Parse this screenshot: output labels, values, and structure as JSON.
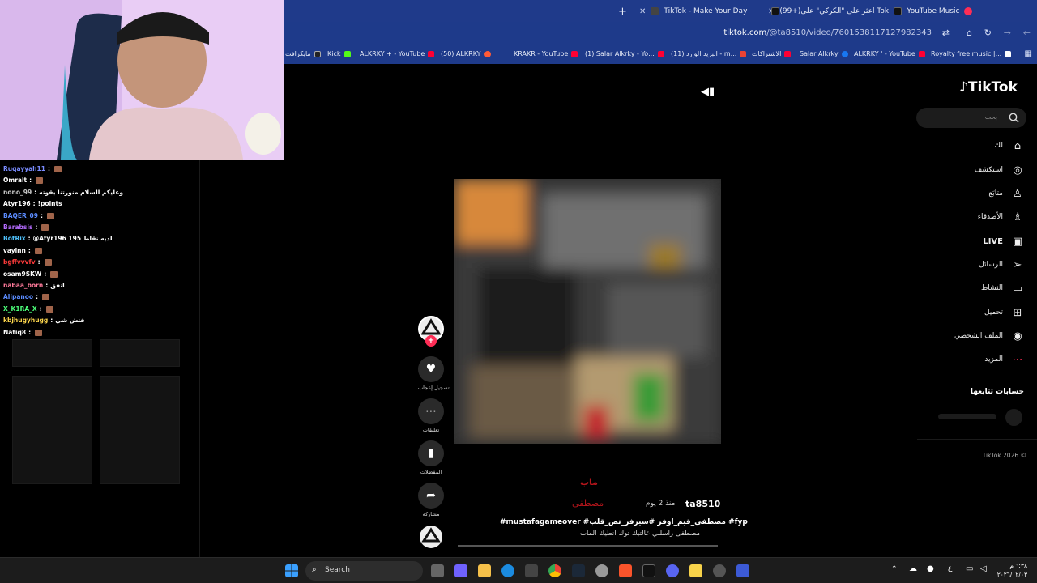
{
  "browser": {
    "tabs": [
      {
        "label": "YouTube Music"
      },
      {
        "label": "(99+)اعثر على \"الكركي\" على Tok"
      },
      {
        "label": "TikTok - Make Your Day"
      }
    ],
    "new_tab_symbol": "+",
    "url_domain": "tiktok.com",
    "url_path": "/@ta8510/video/7601538117127982343",
    "bookmarks": [
      "Royalty free music |...",
      "ALKRKY ' - YouTube",
      "Salar Alkrky",
      "الاشتراكات",
      "البريد الوارد (11) - m...",
      "(1) Salar Alkrky - Yo...",
      "KRAKR - YouTube",
      "(50) ALKRKY",
      "ALKRKY + - YouTube",
      "Kick",
      "مايكرافت"
    ]
  },
  "tiktok": {
    "logo": "TikTok",
    "search_placeholder": "بحث",
    "nav": [
      {
        "label": "لك",
        "icon": "home-icon"
      },
      {
        "label": "استكشف",
        "icon": "compass-icon"
      },
      {
        "label": "متابَع",
        "icon": "user-follow-icon"
      },
      {
        "label": "الأصدقاء",
        "icon": "friends-icon"
      },
      {
        "label": "LIVE",
        "icon": "live-icon"
      },
      {
        "label": "الرسائل",
        "icon": "send-icon"
      },
      {
        "label": "النشاط",
        "icon": "activity-icon"
      },
      {
        "label": "تحميل",
        "icon": "upload-icon"
      },
      {
        "label": "الملف الشخصي",
        "icon": "profile-avatar-icon"
      },
      {
        "label": "المزيد",
        "icon": "more-icon"
      }
    ],
    "following_heading": "حسابات تتابعها",
    "footer": "TikTok 2026 ©",
    "video": {
      "author": "ta8510",
      "time": "منذ 2 يوم",
      "overlay_line1": "ماب",
      "overlay_line2": "مصطفى",
      "hashtags": "#mustafagameover #مصطفى_قيم_اوفر #سيرفر_نص_قلب #fyp",
      "caption": "مصطفى راسلني عالتيك توك انطيك الماب"
    },
    "actions": [
      {
        "label": "تسجيل إعجاب",
        "icon": "heart-icon"
      },
      {
        "label": "تعليقات",
        "icon": "comment-icon"
      },
      {
        "label": "المفضلات",
        "icon": "bookmark-icon"
      },
      {
        "label": "مشاركة",
        "icon": "share-icon"
      }
    ],
    "follow_badge": "+"
  },
  "chat": {
    "messages": [
      {
        "user": "Ruqayyah11",
        "sep": ":",
        "text": "",
        "color": "#7a8cff"
      },
      {
        "user": "Omralt",
        "sep": ":",
        "text": "",
        "color": "#ffffff"
      },
      {
        "user": "nono_99",
        "sep": ":",
        "text": "وعليكم السلام منورتنا بقوته",
        "color": "#c5c5c5"
      },
      {
        "user": "Atyr196",
        "sep": ":",
        "text": "!points",
        "color": "#ffffff"
      },
      {
        "user": "BAQER_09",
        "sep": ":",
        "text": "",
        "color": "#5b8cff"
      },
      {
        "user": "Barabsis",
        "sep": ":",
        "text": "",
        "color": "#b56cff"
      },
      {
        "user": "BotRix",
        "sep": ":",
        "text": "@Atyr196 195 لديه نقاط",
        "color": "#4fc3ff"
      },
      {
        "user": "vaylnn",
        "sep": ":",
        "text": "",
        "color": "#ffffff"
      },
      {
        "user": "bgffvvvfv",
        "sep": ":",
        "text": "",
        "color": "#ff3b3b"
      },
      {
        "user": "osam9SKW",
        "sep": ":",
        "text": "",
        "color": "#ffffff"
      },
      {
        "user": "nabaa_born",
        "sep": ":",
        "text": "اتفق",
        "color": "#ff7a9a"
      },
      {
        "user": "Alipanoo",
        "sep": ":",
        "text": "",
        "color": "#5b8cff"
      },
      {
        "user": "X_K1RA_X",
        "sep": ":",
        "text": "",
        "color": "#4dff7a"
      },
      {
        "user": "kbjhugyhugg",
        "sep": ":",
        "text": "فتش شي",
        "color": "#ffd84d"
      },
      {
        "user": "Natiq8",
        "sep": ":",
        "text": "",
        "color": "#ffffff"
      }
    ]
  },
  "taskbar": {
    "search_label": "Search",
    "time": "٦:٣٨ م",
    "date": "٢٠٢٦/٠٢/٠٣",
    "lang": "ع"
  }
}
